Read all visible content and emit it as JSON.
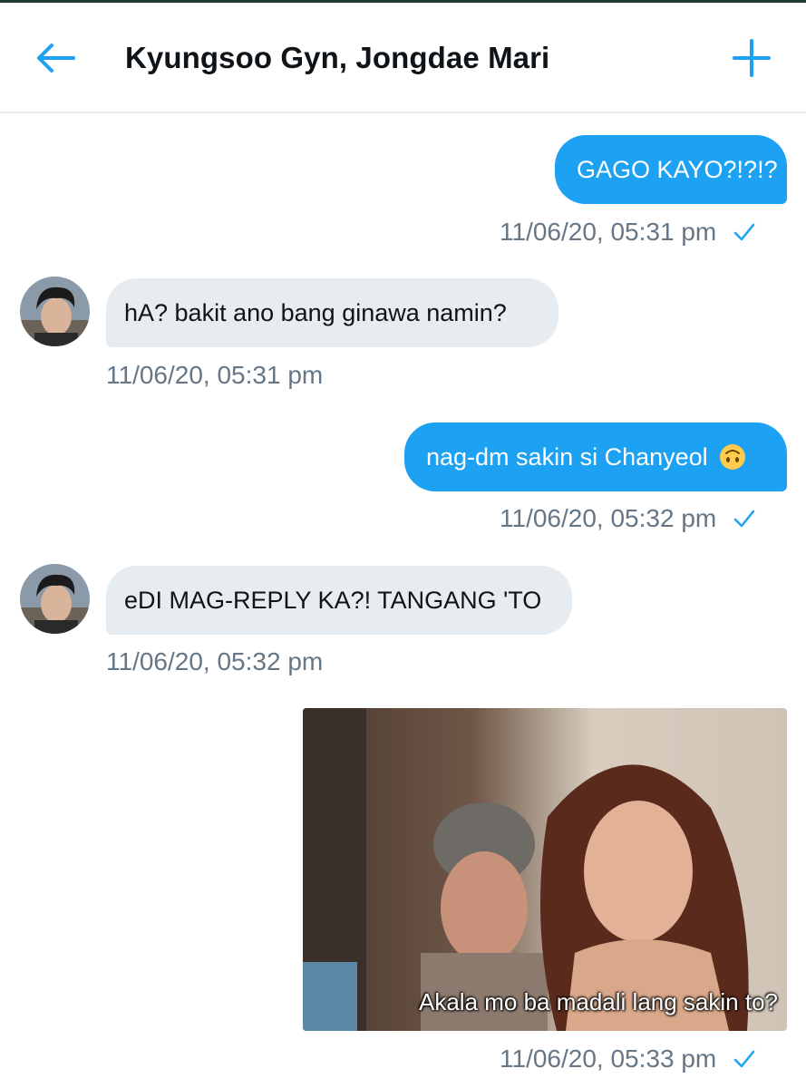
{
  "header": {
    "title": "Kyungsoo Gyn, Jongdae Mari",
    "back_icon": "arrow-left-icon",
    "add_icon": "plus-icon",
    "accent_color": "#1da1f2"
  },
  "messages": [
    {
      "direction": "out",
      "text": "GAGO KAYO?!?!?",
      "timestamp": "11/06/20, 05:31 pm",
      "status_icon": "check-icon"
    },
    {
      "direction": "in",
      "text": "hA? bakit ano bang ginawa namin?",
      "timestamp": "11/06/20, 05:31 pm",
      "avatar_icon": "avatar"
    },
    {
      "direction": "out",
      "text": "nag-dm sakin si Chanyeol",
      "emoji": "upside-down-face-emoji",
      "timestamp": "11/06/20, 05:32 pm",
      "status_icon": "check-icon"
    },
    {
      "direction": "in",
      "text": "eDI MAG-REPLY KA?! TANGANG 'TO",
      "timestamp": "11/06/20, 05:32 pm",
      "avatar_icon": "avatar"
    },
    {
      "direction": "out",
      "type": "image",
      "caption": "Akala mo ba madali lang sakin to?",
      "timestamp": "11/06/20, 05:33 pm",
      "status_icon": "check-icon"
    }
  ],
  "colors": {
    "outgoing_bubble": "#1da1f2",
    "incoming_bubble": "#e6ecf0",
    "timestamp": "#657786"
  }
}
